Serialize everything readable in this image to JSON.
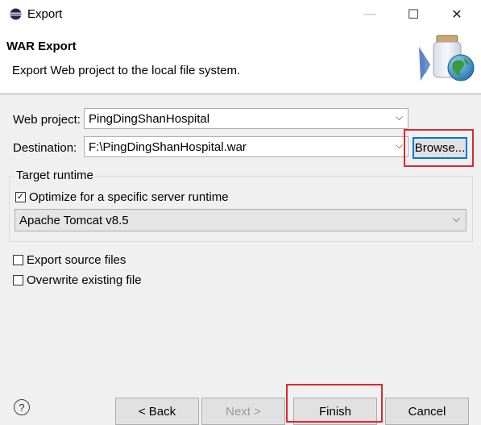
{
  "window": {
    "title": "Export",
    "minimize": "—",
    "maximize": "☐",
    "close": "✕"
  },
  "header": {
    "title": "WAR Export",
    "description": "Export Web project to the local file system."
  },
  "form": {
    "web_project_label": "Web project:",
    "web_project_value": "PingDingShanHospital",
    "destination_label": "Destination:",
    "destination_value": "F:\\PingDingShanHospital.war",
    "browse_label": "Browse..."
  },
  "target_runtime": {
    "group_title": "Target runtime",
    "optimize_label": "Optimize for a specific server runtime",
    "optimize_checked": true,
    "runtime_value": "Apache Tomcat v8.5"
  },
  "options": {
    "export_source_label": "Export source files",
    "export_source_checked": false,
    "overwrite_label": "Overwrite existing file",
    "overwrite_checked": false
  },
  "buttons": {
    "back": "< Back",
    "next": "Next >",
    "finish": "Finish",
    "cancel": "Cancel"
  },
  "icons": {
    "help": "?",
    "dropdown": "⌵",
    "check": "✓"
  },
  "colors": {
    "highlight": "#e0262d",
    "focus": "#0078d7"
  }
}
